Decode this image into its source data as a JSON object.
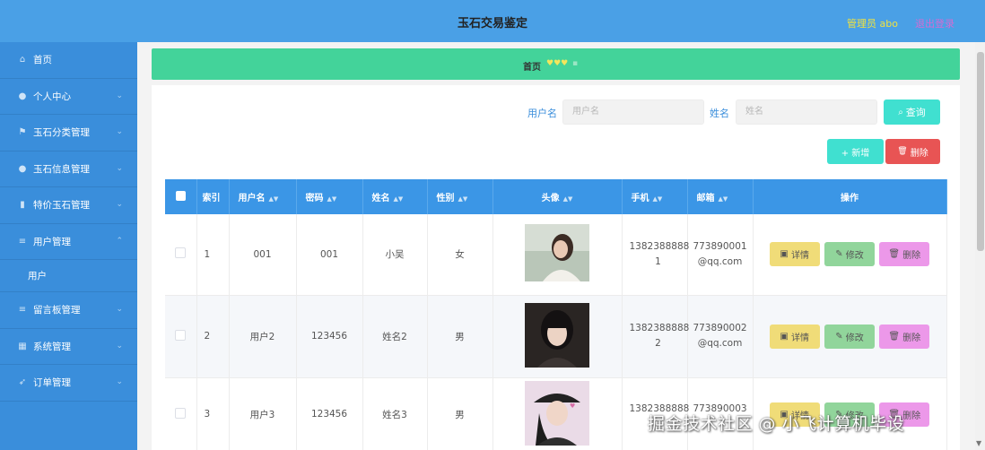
{
  "header": {
    "title": "玉石交易鉴定",
    "admin": "管理员 abo",
    "logout": "退出登录"
  },
  "sidebar": {
    "items": [
      {
        "label": "首页",
        "icon": "home-icon"
      },
      {
        "label": "个人中心",
        "icon": "user-icon"
      },
      {
        "label": "玉石分类管理",
        "icon": "flag-icon"
      },
      {
        "label": "玉石信息管理",
        "icon": "user-icon"
      },
      {
        "label": "特价玉石管理",
        "icon": "chart-icon"
      },
      {
        "label": "用户管理",
        "icon": "list-icon"
      },
      {
        "label": "留言板管理",
        "icon": "list-icon"
      },
      {
        "label": "系统管理",
        "icon": "grid-icon"
      },
      {
        "label": "订单管理",
        "icon": "send-icon"
      }
    ],
    "sub_active": "用户"
  },
  "breadcrumb": {
    "home": "首页"
  },
  "search": {
    "username_label": "用户名",
    "username_placeholder": "用户名",
    "name_label": "姓名",
    "name_placeholder": "姓名",
    "query": "查询"
  },
  "actions": {
    "add": "+ 新增",
    "delete": "删除"
  },
  "table": {
    "headers": [
      "索引",
      "用户名",
      "密码",
      "姓名",
      "性别",
      "头像",
      "手机",
      "邮箱",
      "操作"
    ],
    "rows": [
      {
        "index": "1",
        "username": "001",
        "password": "001",
        "name": "小吴",
        "gender": "女",
        "phone_a": "1382388888",
        "phone_b": "1",
        "email_a": "773890001",
        "email_b": "@qq.com"
      },
      {
        "index": "2",
        "username": "用户2",
        "password": "123456",
        "name": "姓名2",
        "gender": "男",
        "phone_a": "1382388888",
        "phone_b": "2",
        "email_a": "773890002",
        "email_b": "@qq.com"
      },
      {
        "index": "3",
        "username": "用户3",
        "password": "123456",
        "name": "姓名3",
        "gender": "男",
        "phone_a": "1382388888",
        "phone_b": "",
        "email_a": "773890003",
        "email_b": ""
      }
    ],
    "row_actions": {
      "detail": "详情",
      "edit": "修改",
      "delete": "删除"
    }
  },
  "watermark": "掘金技术社区 @ 小飞计算机毕设"
}
